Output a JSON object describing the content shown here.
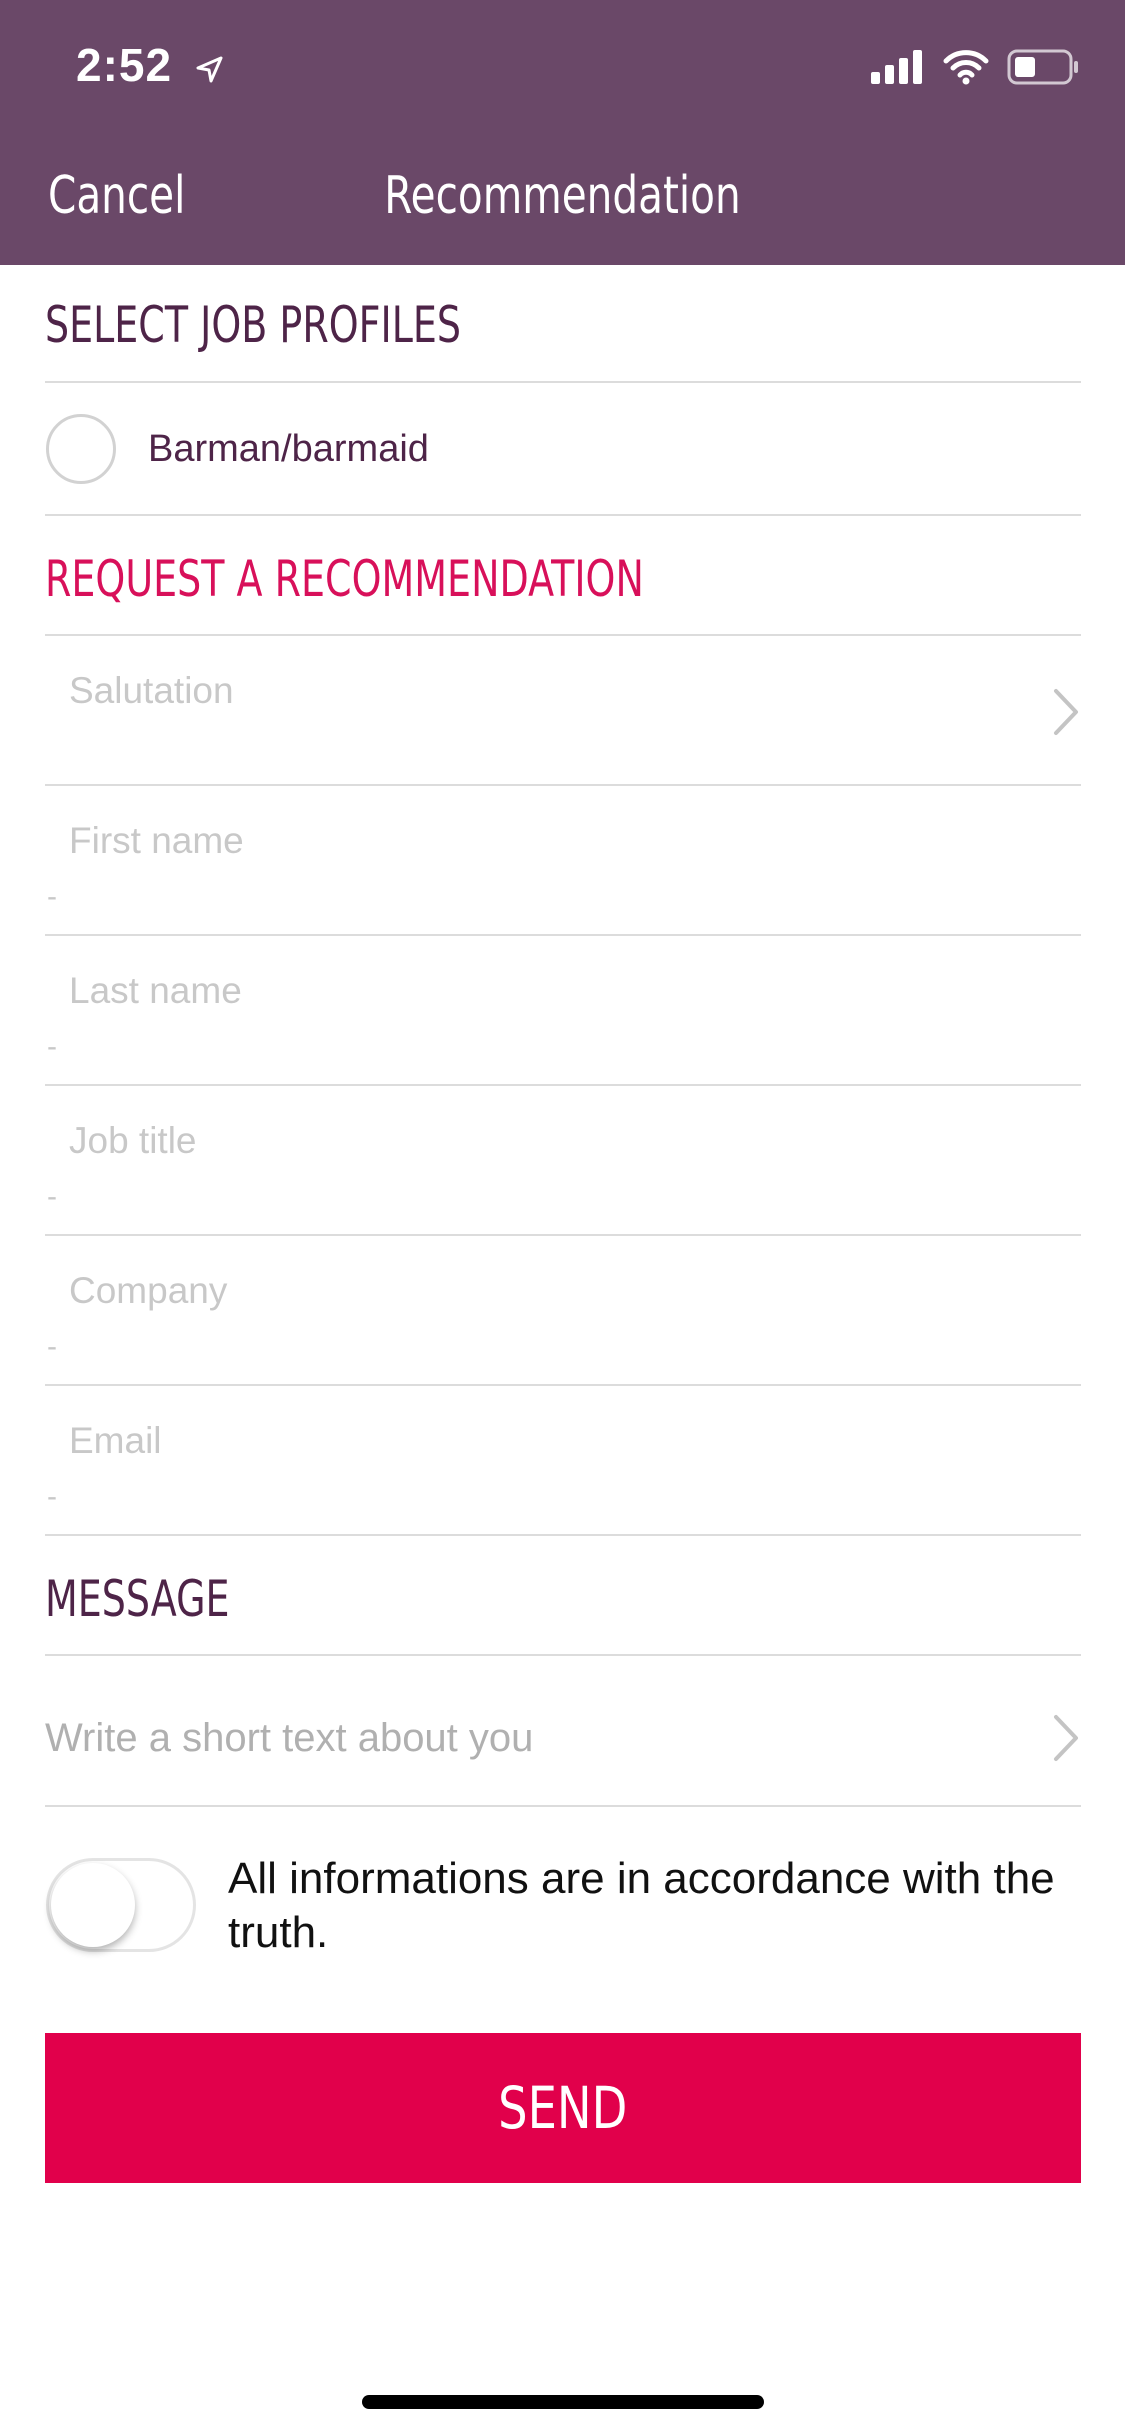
{
  "status_bar": {
    "time": "2:52",
    "icons": [
      "location-arrow-icon",
      "signal-bars-icon",
      "wifi-icon",
      "battery-icon"
    ]
  },
  "nav": {
    "cancel_label": "Cancel",
    "title": "Recommendation"
  },
  "job_profiles": {
    "title": "SELECT JOB PROFILES",
    "options": [
      {
        "label": "Barman/barmaid",
        "selected": false
      }
    ]
  },
  "request": {
    "title": "REQUEST A RECOMMENDATION",
    "fields": {
      "salutation": {
        "label": "Salutation"
      },
      "first_name": {
        "label": "First name",
        "value": "-"
      },
      "last_name": {
        "label": "Last name",
        "value": "-"
      },
      "job_title": {
        "label": "Job title",
        "value": "-"
      },
      "company": {
        "label": "Company",
        "value": "-"
      },
      "email": {
        "label": "Email",
        "value": "-"
      }
    }
  },
  "message": {
    "title": "MESSAGE",
    "placeholder": "Write a short text about you"
  },
  "consent": {
    "text": "All informations are in accordance with the truth.",
    "checked": false
  },
  "send_label": "SEND",
  "colors": {
    "header": "#6a4868",
    "accent": "#e1004b",
    "section_title": "#4e2448",
    "section_title_highlight": "#d8105a"
  }
}
